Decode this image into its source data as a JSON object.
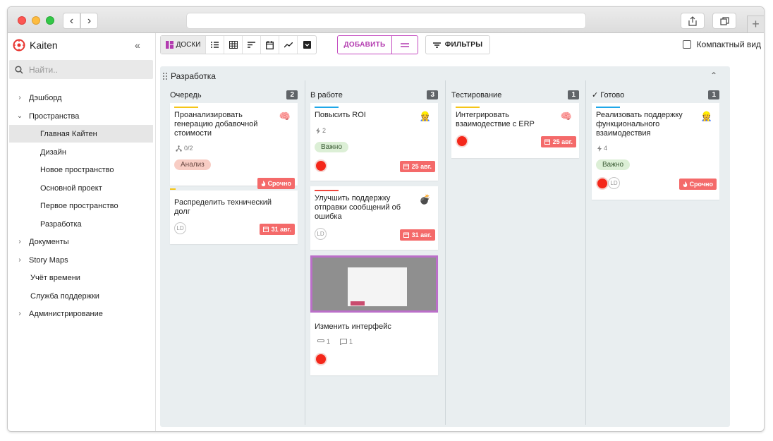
{
  "sidebar": {
    "app_name": "Kaiten",
    "search_placeholder": "Найти..",
    "items": [
      {
        "label": "Дэшборд",
        "chevron": "›"
      },
      {
        "label": "Пространства",
        "chevron": "⌄"
      },
      {
        "label": "Главная Кайтен",
        "chevron": ""
      },
      {
        "label": "Дизайн",
        "chevron": ""
      },
      {
        "label": "Новое пространство",
        "chevron": ""
      },
      {
        "label": "Основной проект",
        "chevron": ""
      },
      {
        "label": "Первое пространство",
        "chevron": ""
      },
      {
        "label": "Разработка",
        "chevron": ""
      },
      {
        "label": "Документы",
        "chevron": "›"
      },
      {
        "label": "Story Maps",
        "chevron": "›"
      },
      {
        "label": "Учёт времени",
        "chevron": ""
      },
      {
        "label": "Служба поддержки",
        "chevron": ""
      },
      {
        "label": "Администрирование",
        "chevron": "›"
      }
    ]
  },
  "toolbar": {
    "boards_label": "ДОСКИ",
    "add_label": "ДОБАВИТЬ",
    "filters_label": "ФИЛЬТРЫ",
    "compact_label": "Компактный вид"
  },
  "board": {
    "title": "Разработка",
    "columns": [
      {
        "title": "Очередь",
        "count": "2"
      },
      {
        "title": "В работе",
        "count": "3"
      },
      {
        "title": "Тестирование",
        "count": "1"
      },
      {
        "title": "✓ Готово",
        "count": "1"
      }
    ],
    "cards": {
      "c1": {
        "title": "Проанализировать генерацию добавочной стоимости",
        "meta": "0/2",
        "tag": "Анализ",
        "badge": "Срочно"
      },
      "c2": {
        "title": "Распределить технический долг",
        "avatar": "LD",
        "due": "31 авг."
      },
      "c3": {
        "title": "Повысить ROI",
        "meta": "2",
        "tag": "Важно",
        "due": "25 авг."
      },
      "c4": {
        "title": "Улучшить поддержку отправки сообщений об ошибка",
        "avatar": "LD",
        "due": "31 авг."
      },
      "c5": {
        "title": "Изменить интерфейс",
        "attachments": "1",
        "comments": "1"
      },
      "c6": {
        "title": "Интегрировать взаимодествие с ERP",
        "due": "25 авг."
      },
      "c7": {
        "title": "Реализовать поддержку функционального взаимодествия",
        "meta": "4",
        "tag": "Важно",
        "avatar": "LD",
        "badge": "Срочно"
      }
    }
  },
  "colors": {
    "accent": "#c44bc0",
    "urgent": "#f46a6a",
    "tag_analysis_bg": "#f8cdc4",
    "tag_important_bg": "#dcefd6",
    "bar_yellow": "#f5c518",
    "bar_blue": "#1ea7e8",
    "bar_red": "#f0483e"
  }
}
